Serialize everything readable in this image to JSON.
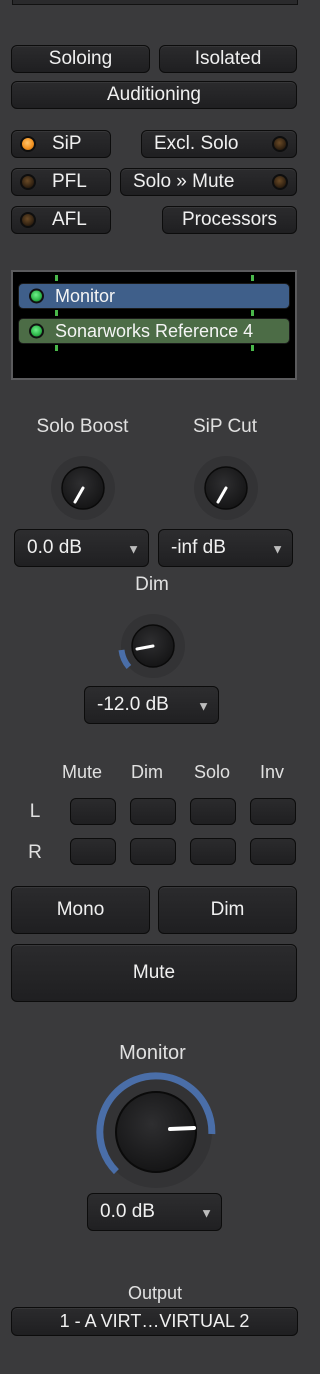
{
  "solo_modes": {
    "soloing": "Soloing",
    "isolated": "Isolated",
    "auditioning": "Auditioning"
  },
  "options": {
    "sip": {
      "label": "SiP",
      "active": true
    },
    "pfl": {
      "label": "PFL",
      "active": false
    },
    "afl": {
      "label": "AFL",
      "active": false
    },
    "excl_solo": {
      "label": "Excl. Solo",
      "active": false
    },
    "solo_mute": {
      "label": "Solo » Mute",
      "active": false
    },
    "processors": "Processors"
  },
  "processors": [
    {
      "name": "Monitor",
      "color": "#3f5f8a"
    },
    {
      "name": "Sonarworks Reference 4",
      "color": "#4c6c46"
    }
  ],
  "solo_boost": {
    "label": "Solo Boost",
    "value": "0.0 dB"
  },
  "sip_cut": {
    "label": "SiP Cut",
    "value": "-inf dB"
  },
  "dim": {
    "label": "Dim",
    "value": "-12.0 dB"
  },
  "channel_matrix": {
    "columns": [
      "Mute",
      "Dim",
      "Solo",
      "Inv"
    ],
    "rows": [
      "L",
      "R"
    ]
  },
  "bottom_buttons": {
    "mono": "Mono",
    "dim": "Dim",
    "mute": "Mute"
  },
  "monitor": {
    "label": "Monitor",
    "value": "0.0 dB"
  },
  "output": {
    "label": "Output",
    "value": "1 - A VIRT…VIRTUAL 2"
  },
  "colors": {
    "background": "#3a3a3c",
    "led_active": "#f39322",
    "knob_arc": "#4a6ea8"
  }
}
